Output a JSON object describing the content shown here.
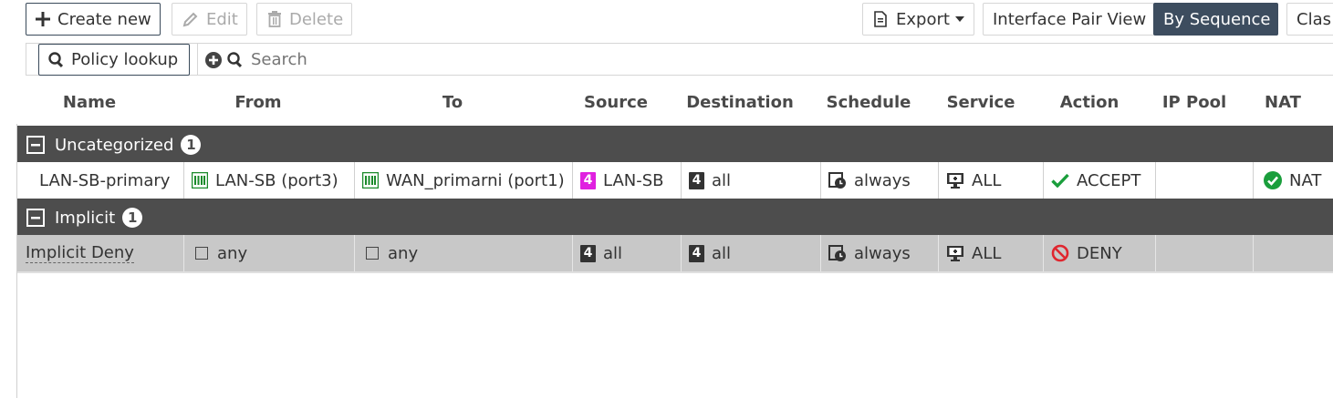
{
  "toolbar": {
    "create_new": "Create new",
    "edit": "Edit",
    "delete": "Delete",
    "export": "Export",
    "view_interface_pair": "Interface Pair View",
    "view_by_sequence": "By Sequence",
    "view_classic": "Clas"
  },
  "search": {
    "policy_lookup": "Policy lookup",
    "placeholder": "Search"
  },
  "columns": [
    "Name",
    "From",
    "To",
    "Source",
    "Destination",
    "Schedule",
    "Service",
    "Action",
    "IP Pool",
    "NAT"
  ],
  "groups": [
    {
      "label": "Uncategorized",
      "count": "1",
      "rows": [
        {
          "name": "LAN-SB-primary",
          "from": "LAN-SB (port3)",
          "to": "WAN_primarni (port1)",
          "source": "LAN-SB",
          "destination": "all",
          "schedule": "always",
          "service": "ALL",
          "action": "ACCEPT",
          "ip_pool": "",
          "nat": "NAT"
        }
      ]
    },
    {
      "label": "Implicit",
      "count": "1",
      "rows": [
        {
          "name": "Implicit Deny",
          "from": "any",
          "to": "any",
          "source": "all",
          "destination": "all",
          "schedule": "always",
          "service": "ALL",
          "action": "DENY",
          "ip_pool": "",
          "nat": ""
        }
      ]
    }
  ],
  "colors": {
    "accent_dark": "#3d4d5f",
    "group_bg": "#4d4d4d",
    "accept_green": "#1a9e3c",
    "deny_red": "#e0262f",
    "source_pink": "#e020e0",
    "implicit_row_bg": "#c8c8c8"
  }
}
